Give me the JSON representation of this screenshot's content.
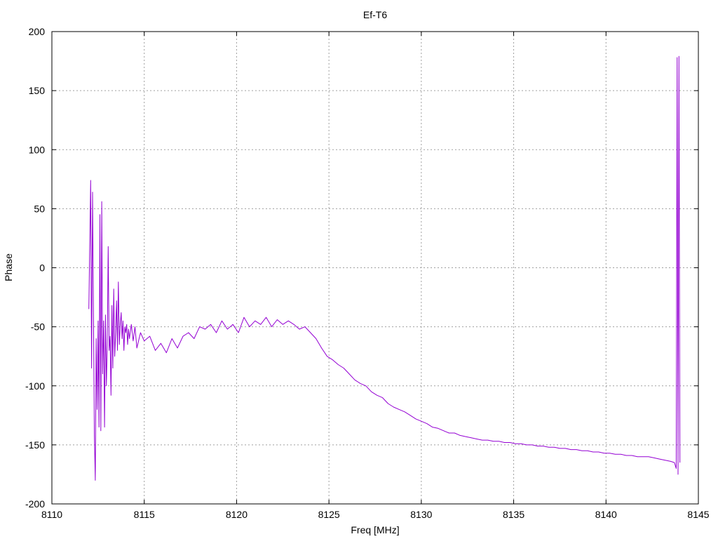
{
  "chart_data": {
    "type": "line",
    "title": "Ef-T6",
    "xlabel": "Freq [MHz]",
    "ylabel": "Phase",
    "xlim": [
      8110,
      8145
    ],
    "ylim": [
      -200,
      200
    ],
    "xticks": [
      8110,
      8115,
      8120,
      8125,
      8130,
      8135,
      8140,
      8145
    ],
    "yticks": [
      -200,
      -150,
      -100,
      -50,
      0,
      50,
      100,
      150,
      200
    ],
    "grid": true,
    "legend": "none",
    "line_color": "#9400d3",
    "series": [
      {
        "x": [
          8112.0,
          8112.1,
          8112.15,
          8112.2,
          8112.25,
          8112.3,
          8112.35,
          8112.4,
          8112.45,
          8112.5,
          8112.55,
          8112.6,
          8112.65,
          8112.7,
          8112.75,
          8112.8,
          8112.85,
          8112.9,
          8112.95,
          8113.0,
          8113.05,
          8113.1,
          8113.15,
          8113.2,
          8113.25,
          8113.3,
          8113.35,
          8113.4,
          8113.45,
          8113.5,
          8113.55,
          8113.6,
          8113.65,
          8113.7,
          8113.75,
          8113.8,
          8113.85,
          8113.9,
          8113.95,
          8114.0,
          8114.05,
          8114.1,
          8114.15,
          8114.2,
          8114.3,
          8114.4,
          8114.5,
          8114.6,
          8114.8,
          8115.0,
          8115.3,
          8115.6,
          8115.9,
          8116.2,
          8116.5,
          8116.8,
          8117.1,
          8117.4,
          8117.7,
          8118.0,
          8118.3,
          8118.6,
          8118.9,
          8119.2,
          8119.5,
          8119.8,
          8120.1,
          8120.4,
          8120.7,
          8121.0,
          8121.3,
          8121.6,
          8121.9,
          8122.2,
          8122.5,
          8122.8,
          8123.1,
          8123.4,
          8123.7,
          8124.0,
          8124.3,
          8124.6,
          8124.9,
          8125.2,
          8125.5,
          8125.8,
          8126.1,
          8126.4,
          8126.7,
          8127.0,
          8127.3,
          8127.6,
          8127.9,
          8128.2,
          8128.5,
          8128.8,
          8129.1,
          8129.4,
          8129.7,
          8130.0,
          8130.3,
          8130.6,
          8130.9,
          8131.2,
          8131.5,
          8131.8,
          8132.1,
          8132.4,
          8132.7,
          8133.0,
          8133.3,
          8133.6,
          8133.9,
          8134.2,
          8134.5,
          8134.8,
          8135.1,
          8135.4,
          8135.7,
          8136.0,
          8136.3,
          8136.6,
          8136.9,
          8137.2,
          8137.5,
          8137.8,
          8138.1,
          8138.4,
          8138.7,
          8139.0,
          8139.3,
          8139.6,
          8139.9,
          8140.2,
          8140.5,
          8140.8,
          8141.1,
          8141.4,
          8141.7,
          8142.0,
          8142.3,
          8142.6,
          8142.9,
          8143.2,
          8143.5,
          8143.7,
          8143.8,
          8143.85,
          8143.9,
          8143.95,
          8144.0
        ],
        "y": [
          -35,
          74,
          -85,
          64,
          -40,
          -142,
          -180,
          -60,
          -120,
          -45,
          -135,
          45,
          -138,
          56,
          -90,
          -45,
          -135,
          -40,
          -100,
          -65,
          18,
          -70,
          -58,
          -108,
          -32,
          -85,
          -18,
          -75,
          -55,
          -28,
          -70,
          -12,
          -65,
          -48,
          -38,
          -60,
          -45,
          -70,
          -50,
          -55,
          -48,
          -65,
          -52,
          -60,
          -48,
          -62,
          -50,
          -68,
          -55,
          -62,
          -58,
          -70,
          -64,
          -72,
          -60,
          -68,
          -58,
          -55,
          -60,
          -50,
          -52,
          -48,
          -55,
          -45,
          -52,
          -48,
          -55,
          -42,
          -50,
          -45,
          -48,
          -42,
          -50,
          -44,
          -48,
          -45,
          -48,
          -52,
          -50,
          -55,
          -60,
          -68,
          -75,
          -78,
          -82,
          -85,
          -90,
          -95,
          -98,
          -100,
          -105,
          -108,
          -110,
          -115,
          -118,
          -120,
          -122,
          -125,
          -128,
          -130,
          -132,
          -135,
          -136,
          -138,
          -140,
          -140,
          -142,
          -143,
          -144,
          -145,
          -146,
          -146,
          -147,
          -147,
          -148,
          -148,
          -149,
          -149,
          -150,
          -150,
          -151,
          -151,
          -152,
          -152,
          -153,
          -153,
          -154,
          -154,
          -155,
          -155,
          -156,
          -156,
          -157,
          -157,
          -158,
          -158,
          -159,
          -159,
          -160,
          -160,
          -160,
          -161,
          -162,
          -163,
          -164,
          -165,
          -170,
          178,
          -175,
          179,
          -165
        ]
      }
    ]
  }
}
